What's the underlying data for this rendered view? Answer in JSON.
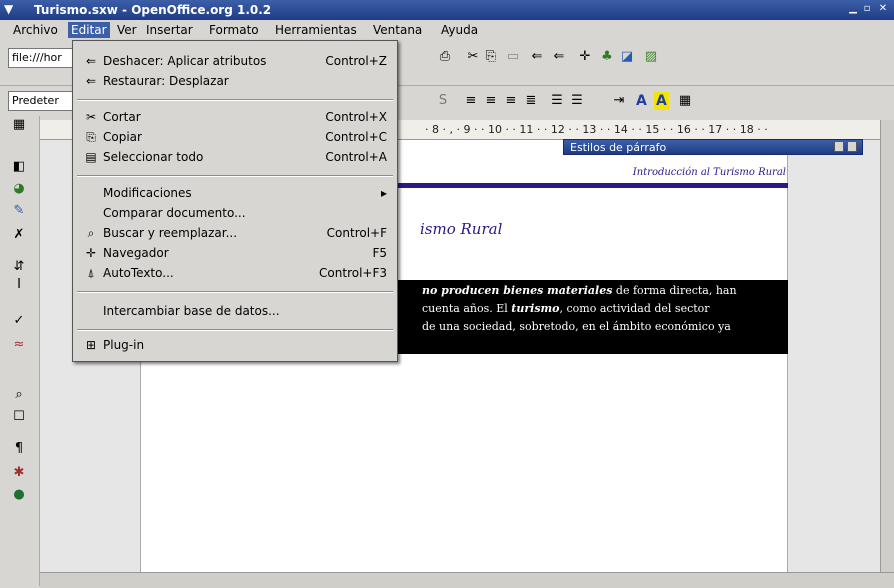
{
  "window": {
    "title": "Turismo.sxw - OpenOffice.org 1.0.2"
  },
  "menubar": {
    "items": [
      "Archivo",
      "Editar",
      "Ver",
      "Insertar",
      "Formato",
      "Herramientas",
      "Ventana",
      "Ayuda"
    ],
    "active": "Editar"
  },
  "toolbar": {
    "url_value": "file:///hor",
    "style_value": "Predeter",
    "text_bold_letter": "A",
    "text_highlight_letter": "A"
  },
  "ruler": {
    "marks": "· 8 · , · 9 · · 10 · · 11 · · 12 · · 13 · · 14 · · 15 · · 16 · · 17 · · 18 · ·"
  },
  "document": {
    "header_text": "Introducción al Turismo Rural",
    "heading": "ismo Rural",
    "para_line1_bold": "no producen bienes materiales",
    "para_line1_rest": " de forma directa, han",
    "para_line2_pre": "cuenta años. El ",
    "para_line2_bold": "turismo",
    "para_line2_rest": ", como actividad del sector",
    "para_line3": "de una sociedad, sobretodo, en el ámbito económico ya"
  },
  "styles_window": {
    "title": "Estilos de párrafo"
  },
  "edit_menu": {
    "items": [
      {
        "icon": "undo-icon",
        "glyph": "⇐",
        "label": "Deshacer: Aplicar atributos",
        "shortcut": "Control+Z"
      },
      {
        "icon": "redo-icon",
        "glyph": "⇐",
        "label": "Restaurar: Desplazar",
        "shortcut": ""
      },
      {
        "icon": "cut-icon",
        "glyph": "✂",
        "label": "Cortar",
        "shortcut": "Control+X"
      },
      {
        "icon": "copy-icon",
        "glyph": "⎘",
        "label": "Copiar",
        "shortcut": "Control+C"
      },
      {
        "icon": "select-all-icon",
        "glyph": "▤",
        "label": "Seleccionar todo",
        "shortcut": "Control+A"
      },
      {
        "icon": "",
        "glyph": "",
        "label": "Modificaciones",
        "shortcut": "▸"
      },
      {
        "icon": "",
        "glyph": "",
        "label": "Comparar documento...",
        "shortcut": ""
      },
      {
        "icon": "binoculars-icon",
        "glyph": "⌕",
        "label": "Buscar y reemplazar...",
        "shortcut": "Control+F"
      },
      {
        "icon": "navigator-icon",
        "glyph": "✛",
        "label": "Navegador",
        "shortcut": "F5"
      },
      {
        "icon": "autotext-icon",
        "glyph": "⍋",
        "label": "AutoTexto...",
        "shortcut": "Control+F3"
      },
      {
        "icon": "",
        "glyph": "",
        "label": "Intercambiar base de datos...",
        "shortcut": ""
      },
      {
        "icon": "plugin-icon",
        "glyph": "⊞",
        "label": "Plug-in",
        "shortcut": ""
      }
    ]
  },
  "colors": {
    "titlebar": "#1e3c86",
    "menu_active": "#3d5fa8",
    "document_accent": "#2a1a86"
  }
}
